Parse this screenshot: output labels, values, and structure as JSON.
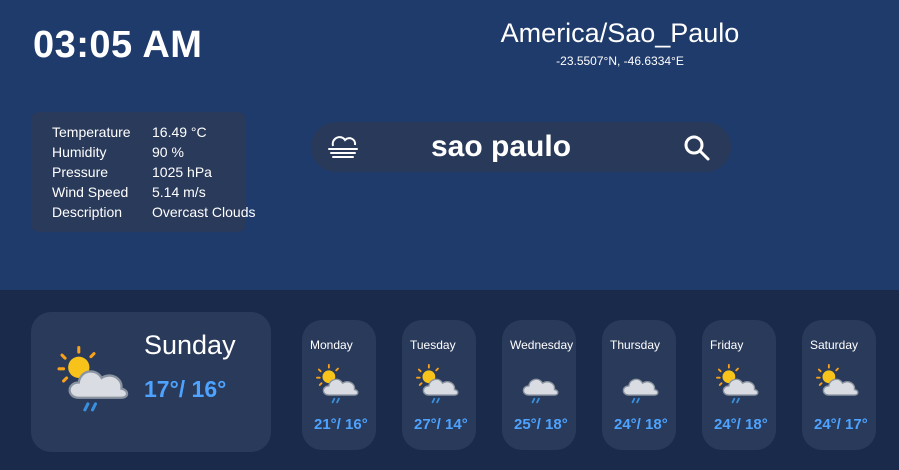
{
  "header": {
    "time": "03:05 AM",
    "timezone": "America/Sao_Paulo",
    "coordinates": "-23.5507°N, -46.6334°E"
  },
  "current": {
    "rows": [
      {
        "label": "Temperature",
        "value": "16.49 °C"
      },
      {
        "label": "Humidity",
        "value": "90 %"
      },
      {
        "label": "Pressure",
        "value": "1025 hPa"
      },
      {
        "label": "Wind Speed",
        "value": "5.14 m/s"
      },
      {
        "label": "Description",
        "value": "Overcast Clouds"
      }
    ]
  },
  "search": {
    "value": "sao paulo",
    "left_icon": "fog-icon",
    "right_icon": "search-icon"
  },
  "today": {
    "day": "Sunday",
    "temp": "17°/ 16°",
    "icon": "sun-cloud-rain-icon"
  },
  "forecast": [
    {
      "day": "Monday",
      "temp": "21°/ 16°",
      "icon": "sun-cloud-rain-icon"
    },
    {
      "day": "Tuesday",
      "temp": "27°/ 14°",
      "icon": "sun-cloud-rain-icon"
    },
    {
      "day": "Wednesday",
      "temp": "25°/ 18°",
      "icon": "cloud-rain-icon"
    },
    {
      "day": "Thursday",
      "temp": "24°/ 18°",
      "icon": "cloud-rain-icon"
    },
    {
      "day": "Friday",
      "temp": "24°/ 18°",
      "icon": "sun-cloud-rain-icon"
    },
    {
      "day": "Saturday",
      "temp": "24°/ 17°",
      "icon": "sun-cloud-icon"
    }
  ],
  "colors": {
    "top_bg": "#1f3b6c",
    "bottom_bg": "#1a2a4a",
    "card_bg": "#2a3a5a",
    "accent_temp": "#4da3ff"
  }
}
